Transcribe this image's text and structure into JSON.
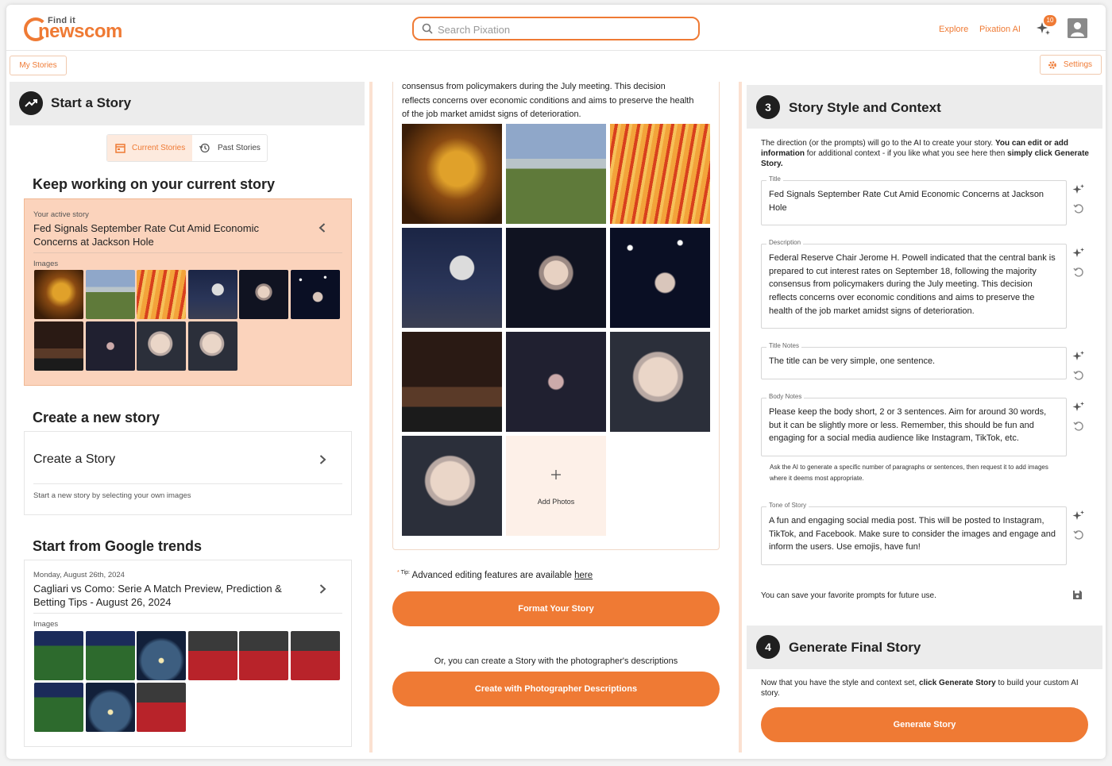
{
  "header": {
    "logo_top": "Find it",
    "logo_word": "newscom",
    "search_placeholder": "Search Pixation",
    "nav": [
      "Explore",
      "Pixation AI"
    ],
    "notification_count": "10"
  },
  "subbar": {
    "my_stories": "My Stories",
    "settings": "Settings"
  },
  "left": {
    "panel_title": "Start a Story",
    "tabs": [
      "Current Stories",
      "Past Stories"
    ],
    "current_heading": "Keep working on your current story",
    "active_label": "Your active story",
    "active_title": "Fed Signals September Rate Cut Amid Economic Concerns at Jackson Hole",
    "images_label": "Images",
    "create_heading": "Create a new story",
    "create_title": "Create a Story",
    "create_desc": "Start a new story by selecting your own images",
    "trends_heading": "Start from Google trends",
    "trend_date": "Monday, August 26th, 2024",
    "trend_title": "Cagliari vs Como: Serie A Match Preview, Prediction & Betting Tips - August 26, 2024"
  },
  "middle": {
    "desc_tail": "consensus from policymakers during the July meeting. This decision reflects concerns over economic conditions and aims to preserve the health of the job market amidst signs of deterioration.",
    "add_photos": "Add Photos",
    "tip_label": "Tip:",
    "tip_text": "Advanced editing features are available",
    "tip_link": "here",
    "format_btn": "Format Your Story",
    "or_text": "Or, you can create a Story with the photographer's descriptions",
    "photog_btn": "Create with Photographer Descriptions"
  },
  "right": {
    "step3_num": "3",
    "step3_title": "Story Style and Context",
    "intro_a": "The direction (or the prompts) will go to the AI to create your story.",
    "intro_b": "You can edit or add information",
    "intro_c": "for additional context - if you like what you see here then",
    "intro_d": "simply click Generate Story.",
    "fields": [
      {
        "label": "Title",
        "value": "Fed Signals September Rate Cut Amid Economic Concerns at Jackson Hole"
      },
      {
        "label": "Description",
        "value": "Federal Reserve Chair Jerome H. Powell indicated that the central bank is prepared to cut interest rates on September 18, following the majority consensus from policymakers during the July meeting. This decision reflects concerns over economic conditions and aims to preserve the health of the job market amidst signs of deterioration."
      },
      {
        "label": "Title Notes",
        "value": "The title can be very simple, one sentence."
      },
      {
        "label": "Body Notes",
        "value": "Please keep the body short, 2 or 3 sentences. Aim for around 30 words, but it can be slightly more or less. Remember, this should be fun and engaging for a social media audience like Instagram, TikTok, etc."
      },
      {
        "label": "Tone of Story",
        "value": "A fun and engaging social media post. This will be posted to Instagram, TikTok, and Facebook. Make sure to consider the images and engage and inform the users. Use emojis, have fun!"
      }
    ],
    "body_hint": "Ask the AI to generate a specific number of paragraphs or sentences, then request it to add images where it deems most appropriate.",
    "save_text": "You can save your favorite prompts for future use.",
    "step4_num": "4",
    "step4_title": "Generate Final Story",
    "final_a": "Now that you have the style and context set,",
    "final_b": "click Generate Story",
    "final_c": "to build your custom AI story.",
    "generate_btn": "Generate Story"
  },
  "colors": {
    "accent": "#ef7a34",
    "accent_light": "#fbd3bc",
    "panel_gray": "#ececec"
  }
}
